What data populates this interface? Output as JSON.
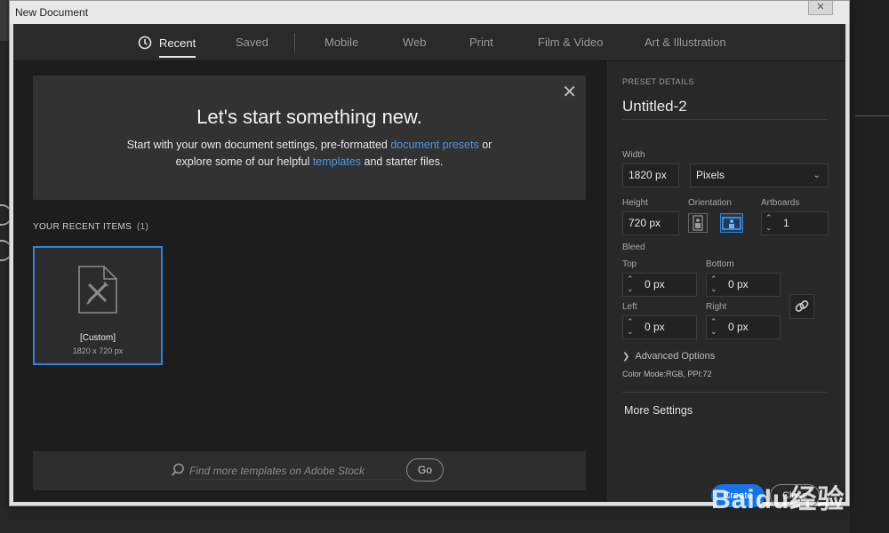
{
  "window": {
    "title": "New Document",
    "close_glyph": "✕"
  },
  "tabs": [
    {
      "label": "Recent",
      "active": true,
      "icon": "clock-icon"
    },
    {
      "label": "Saved"
    },
    {
      "label": "Mobile"
    },
    {
      "label": "Web"
    },
    {
      "label": "Print"
    },
    {
      "label": "Film & Video"
    },
    {
      "label": "Art & Illustration"
    }
  ],
  "hero": {
    "close_glyph": "✕",
    "heading": "Let's start something new.",
    "line1_pre": "Start with your own document settings, pre-formatted ",
    "line1_link": "document presets",
    "line1_post": " or",
    "line2_pre": "explore some of our helpful ",
    "line2_link": "templates",
    "line2_post": " and starter files."
  },
  "recent": {
    "heading": "YOUR RECENT ITEMS",
    "count": "(1)",
    "items": [
      {
        "name": "[Custom]",
        "dims": "1820 x 720 px"
      }
    ]
  },
  "stock": {
    "placeholder": "Find more templates on Adobe Stock",
    "go_label": "Go"
  },
  "preset": {
    "heading": "PRESET DETAILS",
    "doc_name": "Untitled-2",
    "width_label": "Width",
    "width_value": "1820 px",
    "units": "Pixels",
    "height_label": "Height",
    "height_value": "720 px",
    "orientation_label": "Orientation",
    "artboards_label": "Artboards",
    "artboards_value": "1",
    "bleed_label": "Bleed",
    "top_label": "Top",
    "top_value": "0 px",
    "bottom_label": "Bottom",
    "bottom_value": "0 px",
    "left_label": "Left",
    "left_value": "0 px",
    "right_label": "Right",
    "right_value": "0 px",
    "advanced_label": "Advanced Options",
    "color_mode": "Color Mode:RGB, PPI:72",
    "more_settings": "More Settings",
    "create_label": "Create",
    "close_label": "Close"
  },
  "watermark": "Baidu经验",
  "colors": {
    "accent": "#2d85e0",
    "link": "#4e96e6",
    "button": "#1473e6"
  }
}
